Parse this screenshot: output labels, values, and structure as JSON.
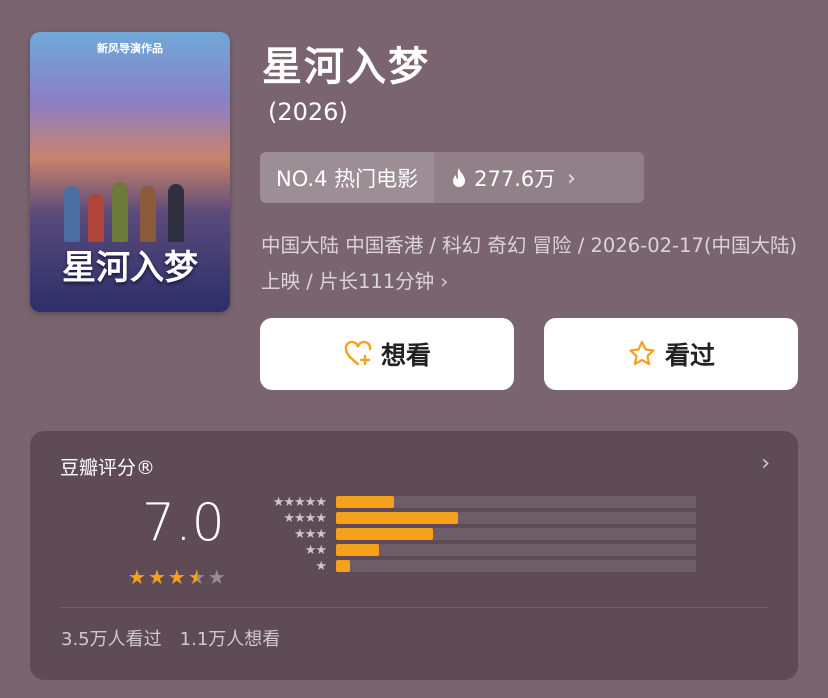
{
  "movie": {
    "title": "星河入梦",
    "year": "(2026)",
    "poster_tag": "新风导演作品",
    "poster_title": "星河入梦"
  },
  "ranking": {
    "rank_label": "NO.4 热门电影",
    "heat_value": "277.6万",
    "heat_icon": "flame-icon"
  },
  "meta_text": "中国大陆 中国香港 / 科幻 奇幻 冒险 / 2026-02-17(中国大陆) 上映 / 片长111分钟",
  "actions": {
    "want_label": "想看",
    "seen_label": "看过",
    "accent": "#f6a11c"
  },
  "rating": {
    "heading": "豆瓣评分®",
    "score": "7.0",
    "stars": 3.5,
    "distribution": [
      {
        "stars": 5,
        "fraction": 0.16
      },
      {
        "stars": 4,
        "fraction": 0.34
      },
      {
        "stars": 3,
        "fraction": 0.27
      },
      {
        "stars": 2,
        "fraction": 0.12
      },
      {
        "stars": 1,
        "fraction": 0.04
      }
    ],
    "seen_count": "3.5万人看过",
    "want_count": "1.1万人想看"
  }
}
